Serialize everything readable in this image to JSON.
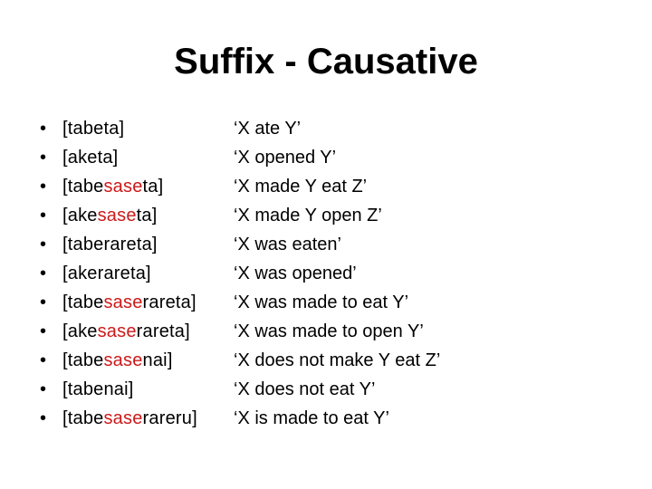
{
  "slide": {
    "title": "Suffix - Causative",
    "accent_color": "#cc1a1a",
    "bullet_glyph": "•",
    "items": [
      {
        "form_parts": [
          {
            "text": "[tabeta]",
            "highlight": false
          }
        ],
        "gloss": "‘X ate Y’"
      },
      {
        "form_parts": [
          {
            "text": "[aketa]",
            "highlight": false
          }
        ],
        "gloss": "‘X opened Y’"
      },
      {
        "form_parts": [
          {
            "text": "[tabe",
            "highlight": false
          },
          {
            "text": "sase",
            "highlight": true
          },
          {
            "text": "ta]",
            "highlight": false
          }
        ],
        "gloss": "‘X made Y eat Z’"
      },
      {
        "form_parts": [
          {
            "text": "[ake",
            "highlight": false
          },
          {
            "text": "sase",
            "highlight": true
          },
          {
            "text": "ta]",
            "highlight": false
          }
        ],
        "gloss": "‘X made Y open Z’"
      },
      {
        "form_parts": [
          {
            "text": "[taberareta]",
            "highlight": false
          }
        ],
        "gloss": "‘X was eaten’"
      },
      {
        "form_parts": [
          {
            "text": "[akerareta]",
            "highlight": false
          }
        ],
        "gloss": "‘X was opened’"
      },
      {
        "form_parts": [
          {
            "text": "[tabe",
            "highlight": false
          },
          {
            "text": "sase",
            "highlight": true
          },
          {
            "text": "rareta]",
            "highlight": false
          }
        ],
        "gloss": "‘X was made to eat Y’"
      },
      {
        "form_parts": [
          {
            "text": "[ake",
            "highlight": false
          },
          {
            "text": "sase",
            "highlight": true
          },
          {
            "text": "rareta]",
            "highlight": false
          }
        ],
        "gloss": "‘X was made to open Y’"
      },
      {
        "form_parts": [
          {
            "text": "[tabe",
            "highlight": false
          },
          {
            "text": "sase",
            "highlight": true
          },
          {
            "text": "nai]",
            "highlight": false
          }
        ],
        "gloss": "‘X does not make Y eat Z’"
      },
      {
        "form_parts": [
          {
            "text": "[tabenai]",
            "highlight": false
          }
        ],
        "gloss": "‘X does not eat Y’"
      },
      {
        "form_parts": [
          {
            "text": "[tabe",
            "highlight": false
          },
          {
            "text": "sase",
            "highlight": true
          },
          {
            "text": "rareru]",
            "highlight": false
          }
        ],
        "gloss": "‘X is made to eat Y’"
      }
    ]
  }
}
